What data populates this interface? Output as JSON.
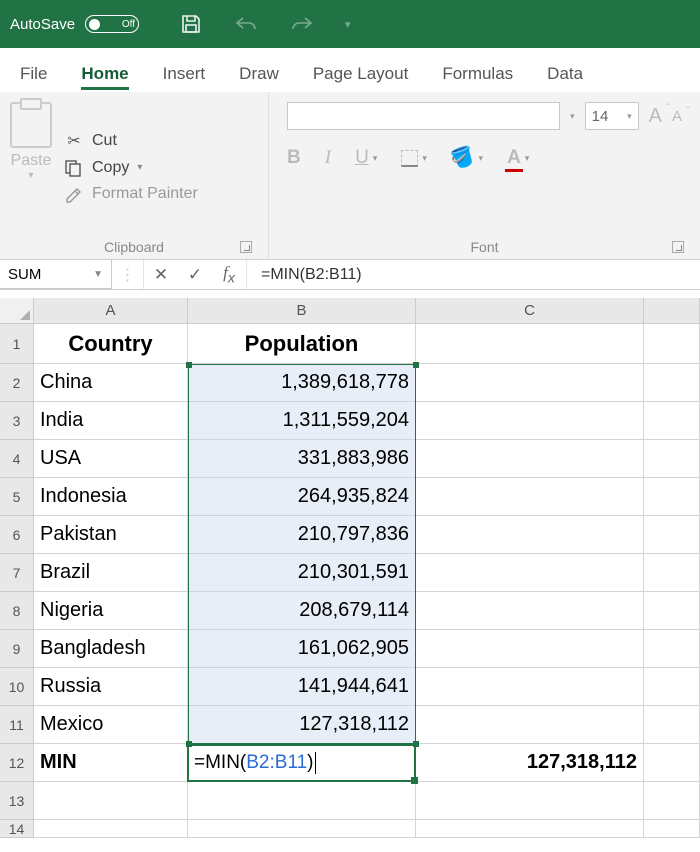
{
  "titlebar": {
    "autosave_label": "AutoSave",
    "autosave_state": "Off"
  },
  "tabs": {
    "file": "File",
    "home": "Home",
    "insert": "Insert",
    "draw": "Draw",
    "page_layout": "Page Layout",
    "formulas": "Formulas",
    "data": "Data"
  },
  "ribbon": {
    "clipboard": {
      "paste": "Paste",
      "cut": "Cut",
      "copy": "Copy",
      "format_painter": "Format Painter",
      "group_label": "Clipboard"
    },
    "font": {
      "size": "14",
      "bold": "B",
      "italic": "I",
      "underline": "U",
      "inc_A": "A",
      "dec_A": "A",
      "color_A": "A",
      "group_label": "Font"
    }
  },
  "formula_bar": {
    "name_box": "SUM",
    "formula": "=MIN(B2:B11)"
  },
  "columns": {
    "A": "A",
    "B": "B",
    "C": "C"
  },
  "headers": {
    "country": "Country",
    "population": "Population"
  },
  "rows": [
    {
      "n": "1"
    },
    {
      "n": "2",
      "country": "China",
      "pop": "1,389,618,778"
    },
    {
      "n": "3",
      "country": "India",
      "pop": "1,311,559,204"
    },
    {
      "n": "4",
      "country": "USA",
      "pop": "331,883,986"
    },
    {
      "n": "5",
      "country": "Indonesia",
      "pop": "264,935,824"
    },
    {
      "n": "6",
      "country": "Pakistan",
      "pop": "210,797,836"
    },
    {
      "n": "7",
      "country": "Brazil",
      "pop": "210,301,591"
    },
    {
      "n": "8",
      "country": "Nigeria",
      "pop": "208,679,114"
    },
    {
      "n": "9",
      "country": "Bangladesh",
      "pop": "161,062,905"
    },
    {
      "n": "10",
      "country": "Russia",
      "pop": "141,944,641"
    },
    {
      "n": "11",
      "country": "Mexico",
      "pop": "127,318,112"
    }
  ],
  "row12": {
    "n": "12",
    "label": "MIN",
    "formula_prefix": "=MIN(",
    "formula_ref": "B2:B11",
    "formula_suffix": ")",
    "result": "127,318,112"
  },
  "row13": {
    "n": "13"
  },
  "row14": {
    "n": "14"
  }
}
